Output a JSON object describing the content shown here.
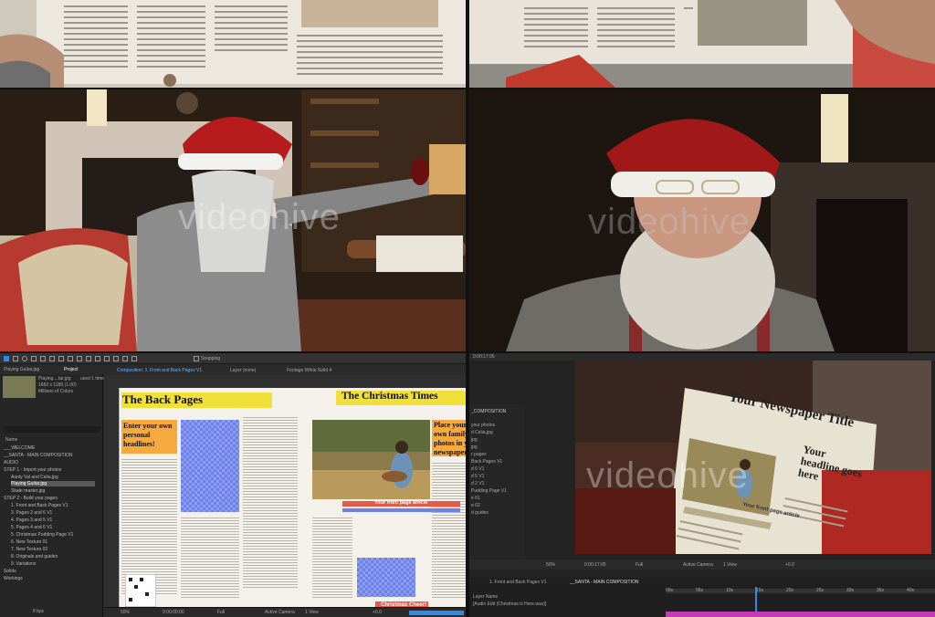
{
  "watermark": "videohive",
  "project_panel": {
    "toolbar_tab": "Project",
    "selected_file_name": "Playing Guitar.jpg",
    "selected_preview_name": "Playing....tar.jpg",
    "selected_used": "used 1 time",
    "selected_dims": "1682 x 1189 (1.00)",
    "selected_colors": "Millions of Colors",
    "column_name": "Name",
    "items": [
      "___WELCOME",
      "__SANTA - MAIN COMPOSITION",
      "AUDIO",
      "STEP 1 - Import your photos",
      "Aunty Val and Celia.jpg",
      "Playing Guitar.jpg",
      "Skate master.jpg",
      "STEP 2 - Build your pages",
      "1. Front and Back Pages V1",
      "3. Pages 2 and 6 V1",
      "4. Pages 3 and 5 V1",
      "5. Pages 4 and 6 V1",
      "5. Christmas Pudding Page V1",
      "6. New Texture 01",
      "7. New Texture 02",
      "8. Originals and guides",
      "9. Variations",
      "Solids",
      "Workings"
    ],
    "bpc": "8 bpc"
  },
  "composition_panel": {
    "tab_label": "Composition: 1. Front and Back Pages V1",
    "layer_label": "Layer (none)",
    "footage_label": "Footage White Solid 4",
    "snapping": "Snapping",
    "zoom": "50%",
    "timecode": "0:00:00:00",
    "resolution": "Full",
    "camera": "Active Camera",
    "view": "1 View",
    "exposure": "+0.0"
  },
  "newspaper": {
    "back_title": "The Back Pages",
    "front_title": "The Christmas Times",
    "back_headline": "Enter your own personal headlines!",
    "front_headline": "Place your own family photos in your newspaper",
    "front_article_label": "Your front page article",
    "footer_label": "Christmas Cheer!"
  },
  "right_editor": {
    "timecode_header": "0:00:17:05",
    "layer_panel_title": "_COMPOSITION",
    "layer_items": [
      "your photos",
      "d Celia.jpg",
      "jpg",
      "jpg",
      "r pages",
      "Back Pages V1",
      "d 6 V1",
      "d 5 V1",
      "d 2 V1",
      "Pudding Page V1",
      "e 01",
      "e 02",
      "d guides"
    ],
    "zoom": "50%",
    "timecode": "0:00:17:05",
    "resolution": "Full",
    "camera": "Active Camera",
    "view": "1 View",
    "exposure": "+0.0",
    "timeline_tab_1": "1. Front and Back Pages V1",
    "timeline_tab_2": "__SANTA - MAIN COMPOSITION",
    "timeline_row": "[Audio Edit (Christmas is Here.wav)]",
    "layer_name_col": "Layer Name",
    "ruler_ticks": [
      "00s",
      "05s",
      "10s",
      "15s",
      "20s",
      "25s",
      "30s",
      "35s",
      "40s"
    ]
  },
  "rendered_newspaper": {
    "masthead": "Your Newspaper Title",
    "headline": "Your headline goes here",
    "article_label": "Your front page article"
  },
  "colors": {
    "ae_panel": "#262626",
    "ae_accent": "#2d8ceb",
    "yellow_header": "#f2e03a",
    "orange_box": "#f6a93c",
    "red_label": "#e35a4a",
    "blue_placeholder": "#6e82e6"
  }
}
